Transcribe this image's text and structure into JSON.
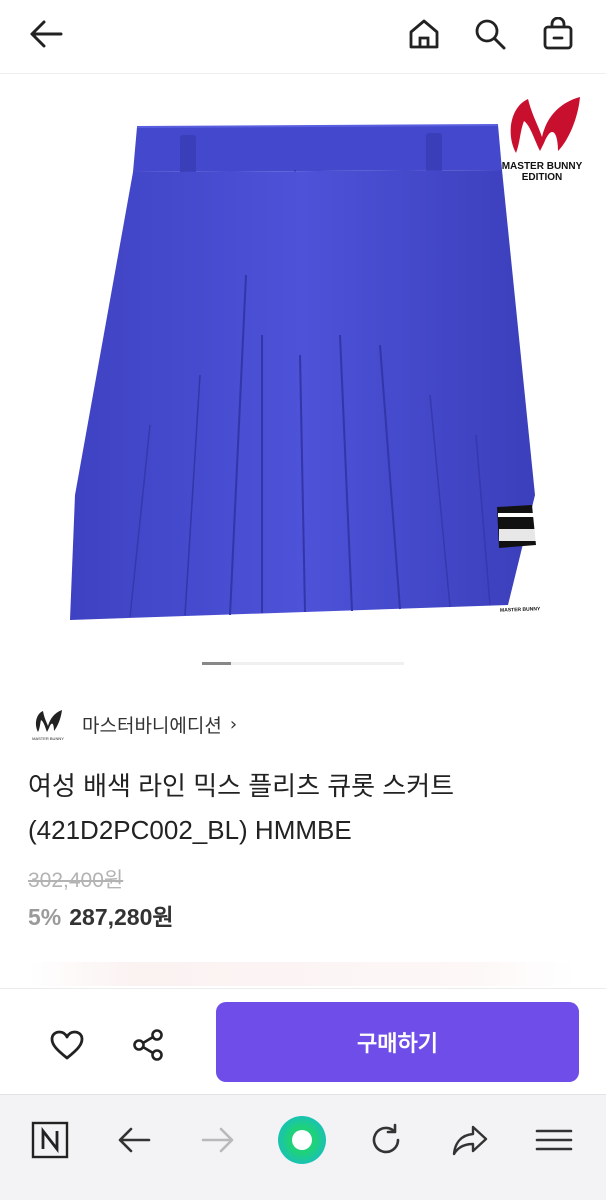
{
  "header": {
    "back_icon": "arrow-left-icon",
    "home_icon": "home-icon",
    "search_icon": "search-icon",
    "cart_icon": "shopping-bag-icon"
  },
  "hero": {
    "brand_logo_text_line1": "MASTER BUNNY",
    "brand_logo_text_line2": "EDITION",
    "skirt_tag_text": "MASTER BUNNY",
    "skirt_color": "#4b4fd1",
    "image_count": 7,
    "current_image": 1
  },
  "product": {
    "seller_name": "마스터바니에디션",
    "seller_chevron": "›",
    "title_line1": "여성 배색 라인 믹스 플리츠 큐롯 스커트",
    "title_line2": "(421D2PC002_BL) HMMBE",
    "original_price": "302,400원",
    "discount_percent": "5%",
    "sale_price": "287,280원"
  },
  "actions": {
    "wishlist_icon": "heart-icon",
    "share_icon": "share-icon",
    "buy_label": "구매하기",
    "buy_color": "#6e4de8"
  },
  "browser": {
    "naver_icon": "naver-n-icon",
    "back_icon": "browser-back-icon",
    "forward_icon": "browser-forward-icon",
    "home_icon": "green-circle-icon",
    "refresh_icon": "refresh-icon",
    "share_icon": "browser-share-icon",
    "menu_icon": "hamburger-menu-icon"
  }
}
